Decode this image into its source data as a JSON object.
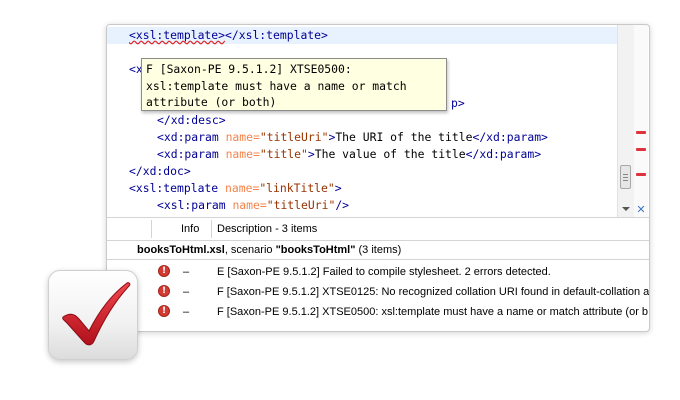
{
  "editor": {
    "lines": [
      [
        {
          "t": "<xsl:template>",
          "c": "tag",
          "sq": true
        },
        {
          "t": "</xsl:template>",
          "c": "tag"
        }
      ],
      [
        {
          "t": "<x",
          "c": "tag"
        }
      ],
      [
        {
          "t": "p>",
          "c": "tag"
        }
      ],
      [
        {
          "t": "</xd:desc>",
          "c": "tag"
        }
      ],
      [
        {
          "t": "<xd:param ",
          "c": "tag"
        },
        {
          "t": "name=",
          "c": "attr"
        },
        {
          "t": "\"titleUri\"",
          "c": "val"
        },
        {
          "t": ">",
          "c": "tag"
        },
        {
          "t": "The URI of the title",
          "c": "txt"
        },
        {
          "t": "</xd:param>",
          "c": "tag"
        }
      ],
      [
        {
          "t": "<xd:param ",
          "c": "tag"
        },
        {
          "t": "name=",
          "c": "attr"
        },
        {
          "t": "\"title\"",
          "c": "val"
        },
        {
          "t": ">",
          "c": "tag"
        },
        {
          "t": "The value of the title",
          "c": "txt"
        },
        {
          "t": "</xd:param>",
          "c": "tag"
        }
      ],
      [
        {
          "t": "</xd:doc>",
          "c": "tag"
        }
      ],
      [
        {
          "t": "<xsl:template ",
          "c": "tag"
        },
        {
          "t": "name=",
          "c": "attr"
        },
        {
          "t": "\"linkTitle\"",
          "c": "val"
        },
        {
          "t": ">",
          "c": "tag"
        }
      ],
      [
        {
          "t": "<xsl:param ",
          "c": "tag"
        },
        {
          "t": "name=",
          "c": "attr"
        },
        {
          "t": "\"titleUri\"",
          "c": "val"
        },
        {
          "t": "/>",
          "c": "tag"
        }
      ]
    ]
  },
  "tooltip": {
    "line1": "F [Saxon-PE 9.5.1.2] XTSE0500:",
    "line2": "xsl:template must have a name or match",
    "line3": "attribute (or both)"
  },
  "tabs": {
    "info": "Info",
    "description": "Description - 3 items"
  },
  "results": {
    "file": "booksToHtml.xsl",
    "scenario_prefix": ", scenario ",
    "scenario": "\"booksToHtml\"",
    "count": " (3 items)",
    "rows": [
      {
        "icon": "!",
        "dash": "–",
        "text": "E [Saxon-PE 9.5.1.2] Failed to compile stylesheet. 2 errors detected."
      },
      {
        "icon": "!",
        "dash": "–",
        "text": "F [Saxon-PE 9.5.1.2] XTSE0125: No recognized collation URI found in default-collation at"
      },
      {
        "icon": "!",
        "dash": "–",
        "text": "F [Saxon-PE 9.5.1.2] XTSE0500: xsl:template must have a name or match attribute (or b"
      }
    ]
  },
  "colors": {
    "error": "#d23c32",
    "checkmark": "#d0141e",
    "tag": "#000096",
    "attribute": "#f5844c",
    "value": "#993300"
  }
}
